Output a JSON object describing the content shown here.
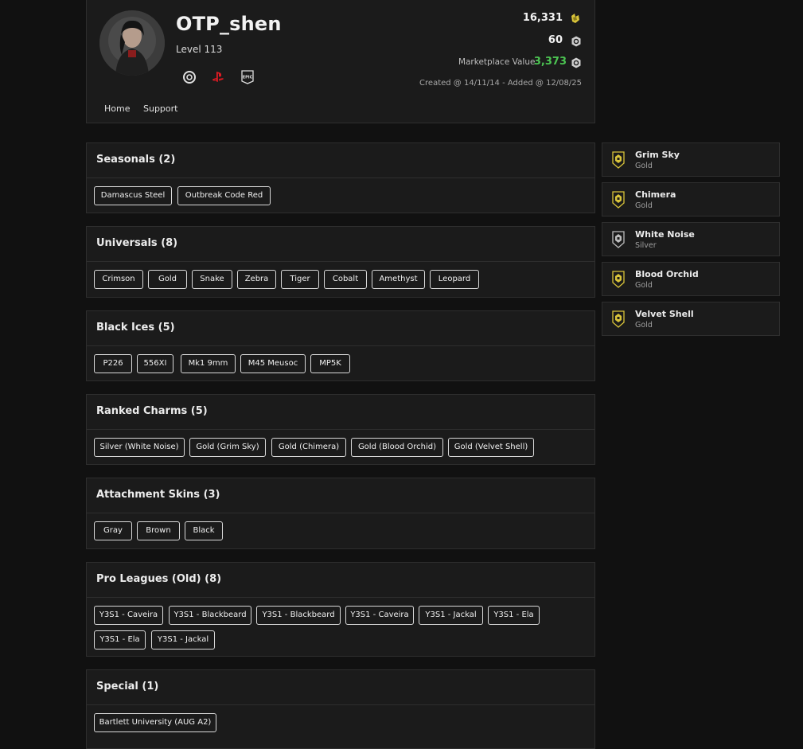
{
  "profile": {
    "username": "OTP_shen",
    "level": "Level 113",
    "credits": "16,331",
    "renown": "60",
    "marketplace_label": "Marketplace Value:",
    "marketplace_value": "3,373",
    "dates": "Created @ 14/11/14 - Added @ 12/08/25",
    "platforms": [
      "ubisoft-icon",
      "playstation-icon",
      "epic-games-icon"
    ],
    "epic_label": "EPIC",
    "nav": {
      "home": "Home",
      "support": "Support"
    }
  },
  "colors": {
    "accent_green": "#4cc552",
    "gold": "#d9c43a",
    "silver": "#bcbcbc"
  },
  "sections": [
    {
      "title": "Seasonals (2)",
      "chips": [
        "Damascus Steel",
        "Outbreak Code Red"
      ]
    },
    {
      "title": "Universals (8)",
      "chips": [
        "Crimson",
        "Gold",
        "Snake",
        "Zebra",
        "Tiger",
        "Cobalt",
        "Amethyst",
        "Leopard"
      ]
    },
    {
      "title": "Black Ices (5)",
      "chips": [
        "P226",
        "556XI",
        "Mk1 9mm",
        "M45 Meusoc",
        "MP5K"
      ]
    },
    {
      "title": "Ranked Charms (5)",
      "chips": [
        "Silver (White Noise)",
        "Gold (Grim Sky)",
        "Gold (Chimera)",
        "Gold (Blood Orchid)",
        "Gold (Velvet Shell)"
      ]
    },
    {
      "title": "Attachment Skins (3)",
      "chips": [
        "Gray",
        "Brown",
        "Black"
      ]
    },
    {
      "title": "Pro Leagues (Old) (8)",
      "chips": [
        "Y3S1 - Caveira",
        "Y3S1 - Blackbeard",
        "Y3S1 - Blackbeard",
        "Y3S1 - Caveira",
        "Y3S1 - Jackal",
        "Y3S1 - Ela",
        "Y3S1 - Ela",
        "Y3S1 - Jackal"
      ]
    },
    {
      "title": "Special (1)",
      "chips": [
        "Bartlett University (AUG A2)"
      ]
    }
  ],
  "charms": [
    {
      "name": "Grim Sky",
      "tier": "Gold"
    },
    {
      "name": "Chimera",
      "tier": "Gold"
    },
    {
      "name": "White Noise",
      "tier": "Silver"
    },
    {
      "name": "Blood Orchid",
      "tier": "Gold"
    },
    {
      "name": "Velvet Shell",
      "tier": "Gold"
    }
  ]
}
